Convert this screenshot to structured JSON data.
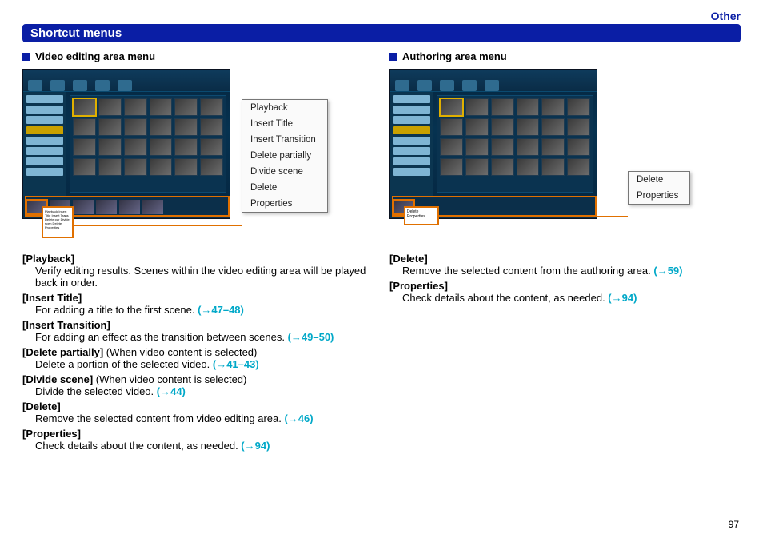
{
  "top_label": "Other",
  "section_title": "Shortcut menus",
  "page_number": "97",
  "left": {
    "subhead": "Video editing area menu",
    "menu": [
      "Playback",
      "Insert Title",
      "Insert Transition",
      "Delete partially",
      "Divide scene",
      "Delete",
      "Properties"
    ],
    "entries": [
      {
        "label": "[Playback]",
        "note": "",
        "body": "Verify editing results. Scenes within the video editing area will be played back in order.",
        "link": ""
      },
      {
        "label": "[Insert Title]",
        "note": "",
        "body": "For adding a title to the first scene. ",
        "link": "(→47–48)"
      },
      {
        "label": "[Insert Transition]",
        "note": "",
        "body": "For adding an effect as the transition between scenes. ",
        "link": "(→49–50)"
      },
      {
        "label": "[Delete partially]",
        "note": " (When video content is selected)",
        "body": "Delete a portion of the selected video. ",
        "link": "(→41–43)"
      },
      {
        "label": "[Divide scene]",
        "note": " (When video content is selected)",
        "body": "Divide the selected video. ",
        "link": "(→44)"
      },
      {
        "label": "[Delete]",
        "note": "",
        "body": "Remove the selected content from video editing area. ",
        "link": "(→46)"
      },
      {
        "label": "[Properties]",
        "note": "",
        "body": "Check details about the content, as needed. ",
        "link": "(→94)"
      }
    ]
  },
  "right": {
    "subhead": "Authoring area menu",
    "menu": [
      "Delete",
      "Properties"
    ],
    "entries": [
      {
        "label": "[Delete]",
        "note": "",
        "body": "Remove the selected content from the authoring area. ",
        "link": "(→59)"
      },
      {
        "label": "[Properties]",
        "note": "",
        "body": "Check details about the content, as needed. ",
        "link": "(→94)"
      }
    ]
  }
}
